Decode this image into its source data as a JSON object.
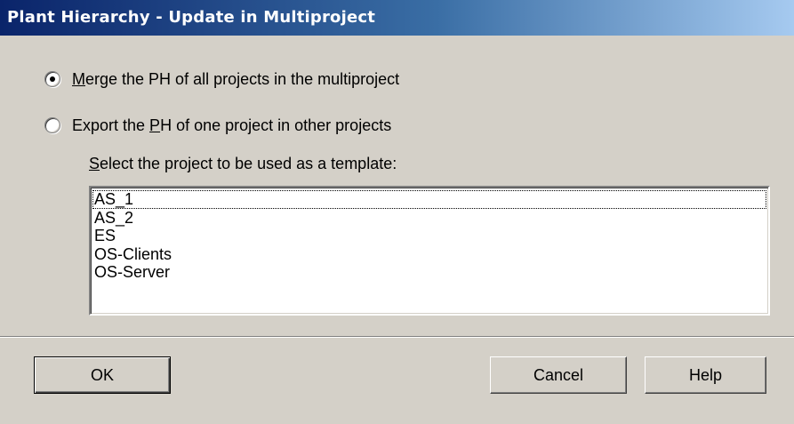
{
  "window": {
    "title": "Plant Hierarchy - Update in Multiproject"
  },
  "options": {
    "merge": {
      "mnemonic": "M",
      "rest": "erge the PH of all projects in the multiproject",
      "checked": true
    },
    "export": {
      "before": "Export the ",
      "mnemonic": "P",
      "after": "H of one project in other projects",
      "checked": false
    }
  },
  "template_select": {
    "mnemonic": "S",
    "rest": "elect the project to be used as a template:",
    "projects": [
      "AS_1",
      "AS_2",
      "ES",
      "OS-Clients",
      "OS-Server"
    ],
    "focused_index": 0
  },
  "buttons": {
    "ok": "OK",
    "cancel": "Cancel",
    "help": "Help"
  }
}
